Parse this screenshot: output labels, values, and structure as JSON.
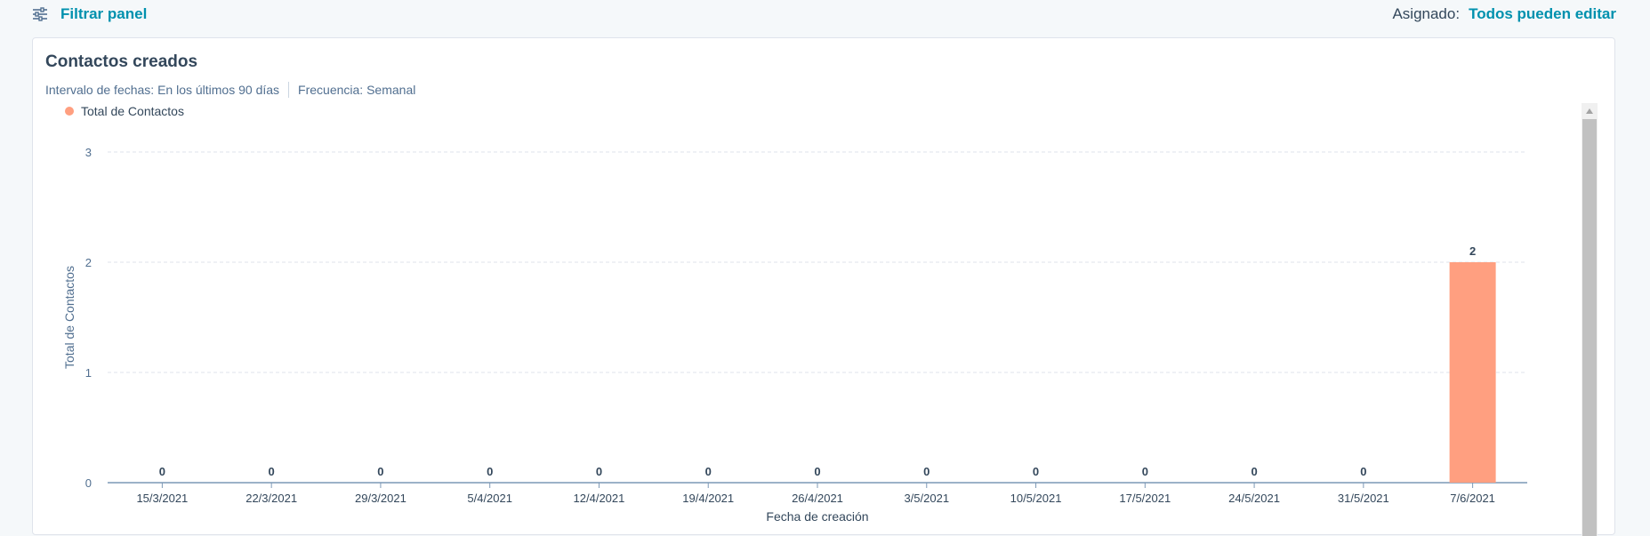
{
  "toolbar": {
    "filter_label": "Filtrar panel",
    "assigned_label": "Asignado:",
    "assigned_value": "Todos pueden editar"
  },
  "report": {
    "title": "Contactos creados",
    "date_range": "Intervalo de fechas: En los últimos 90 días",
    "frequency": "Frecuencia: Semanal"
  },
  "colors": {
    "bar": "#ff9f80",
    "accent": "#0091ae"
  },
  "icons": {
    "filter": "sliders-icon",
    "scroll_up": "caret-up-icon"
  },
  "chart_data": {
    "type": "bar",
    "categories": [
      "15/3/2021",
      "22/3/2021",
      "29/3/2021",
      "5/4/2021",
      "12/4/2021",
      "19/4/2021",
      "26/4/2021",
      "3/5/2021",
      "10/5/2021",
      "17/5/2021",
      "24/5/2021",
      "31/5/2021",
      "7/6/2021"
    ],
    "series": [
      {
        "name": "Total de Contactos",
        "values": [
          0,
          0,
          0,
          0,
          0,
          0,
          0,
          0,
          0,
          0,
          0,
          0,
          2
        ]
      }
    ],
    "xlabel": "Fecha de creación",
    "ylabel": "Total de Contactos",
    "ylim": [
      0,
      3
    ],
    "yticks": [
      0,
      1,
      2,
      3
    ],
    "grid": true,
    "legend": "top-left",
    "data_labels": true
  }
}
